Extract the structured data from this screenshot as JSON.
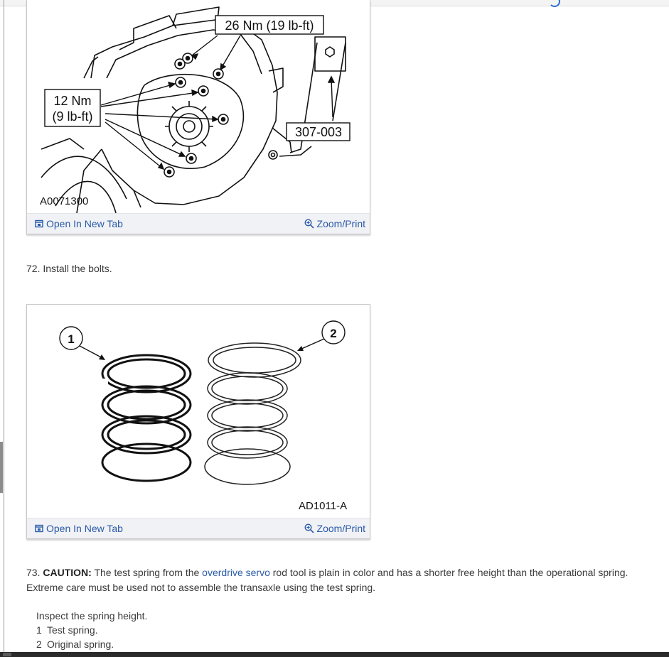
{
  "figure1": {
    "callout_torque_large": "26 Nm (19 lb-ft)",
    "callout_torque_small_line1": "12 Nm",
    "callout_torque_small_line2": "(9 lb-ft)",
    "callout_tool": "307-003",
    "figure_id": "A0071300",
    "open_label": "Open In New Tab",
    "zoom_label": "Zoom/Print"
  },
  "step72": {
    "text": "72. Install the bolts."
  },
  "figure2": {
    "callout_1": "1",
    "callout_2": "2",
    "figure_id": "AD1011-A",
    "open_label": "Open In New Tab",
    "zoom_label": "Zoom/Print"
  },
  "step73": {
    "number": "73.",
    "caution_label": "CAUTION:",
    "text_before_link": "The test spring from the",
    "link_text": "overdrive servo",
    "text_after_link": "rod tool is plain in color and has a shorter free height than the operational spring. Extreme care must be used not to assemble the transaxle using the test spring.",
    "instruction": "Inspect the spring height.",
    "legend": [
      {
        "num": "1",
        "label": "Test spring."
      },
      {
        "num": "2",
        "label": "Original spring."
      }
    ]
  },
  "icons": {
    "open": "open-in-new-tab-icon",
    "zoom": "zoom-in-icon"
  },
  "colors": {
    "link": "#2a5aa8",
    "bar_bg": "#f1f2f5"
  }
}
